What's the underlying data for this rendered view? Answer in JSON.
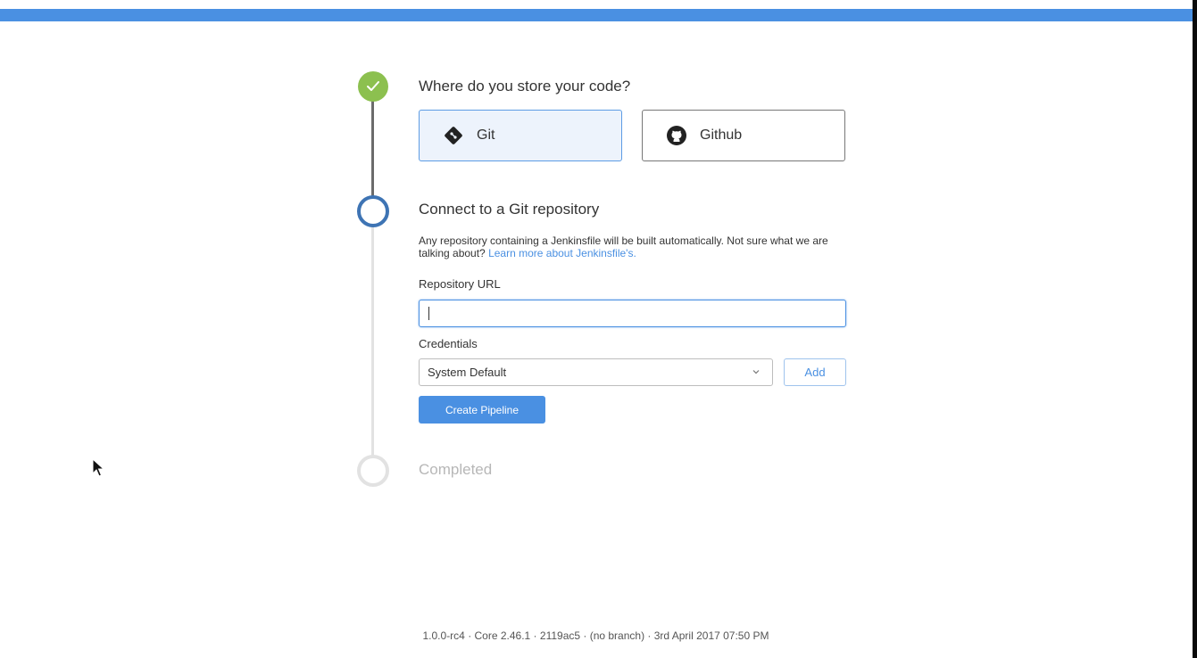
{
  "colors": {
    "accent": "#4a90e2",
    "step_done": "#8cc04f",
    "step_active": "#3e74b4",
    "step_pending": "#e2e2e2"
  },
  "steps": [
    {
      "title": "Where do you store your code?",
      "status": "done",
      "icon": "check-icon"
    },
    {
      "title": "Connect to a Git repository",
      "status": "active"
    },
    {
      "title": "Completed",
      "status": "pending"
    }
  ],
  "sources": {
    "git": {
      "label": "Git",
      "icon": "git-icon",
      "selected": true
    },
    "github": {
      "label": "Github",
      "icon": "github-icon",
      "selected": false
    }
  },
  "connect": {
    "description": "Any repository containing a Jenkinsfile will be built automatically. Not sure what we are talking about?",
    "learn_more_link": "Learn more about Jenkinsfile's.",
    "repo_url_label": "Repository URL",
    "repo_url_value": "",
    "credentials_label": "Credentials",
    "credentials_selected": "System Default",
    "add_label": "Add",
    "create_label": "Create Pipeline"
  },
  "footer": {
    "version_text": "1.0.0-rc4 · Core 2.46.1 · 2119ac5 · (no branch) · 3rd April 2017 07:50 PM"
  }
}
